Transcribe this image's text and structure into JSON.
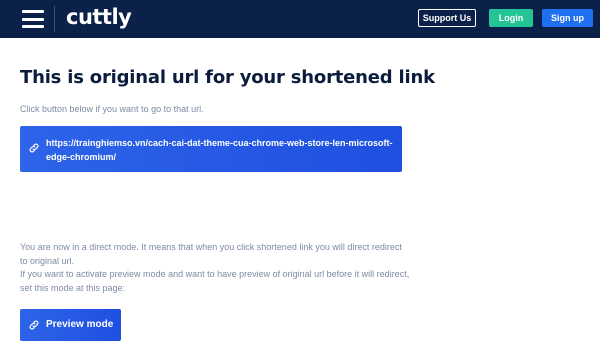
{
  "header": {
    "logo_text": "cuttly",
    "support_label": "Support Us",
    "login_label": "Login",
    "signup_label": "Sign up"
  },
  "main": {
    "title": "This is original url for your shortened link",
    "subtitle": "Click button below if you want to go to that url.",
    "original_url": "https://trainghiemso.vn/cach-cai-dat-theme-cua-chrome-web-store-len-microsoft-edge-chromium/",
    "info_line_1": "You are now in a direct mode. It means that when you click shortened link you will direct redirect to original url.",
    "info_line_2": "If you want to activate preview mode and want to have preview of original url before it will redirect, set this mode at this page:",
    "preview_label": "Preview mode"
  },
  "colors": {
    "navbar": "#0b2149",
    "login": "#24c497",
    "signup": "#1f6ff2",
    "button_blue": "#2d64e8"
  },
  "icons": {
    "menu": "hamburger-menu-icon",
    "link": "link-icon"
  }
}
